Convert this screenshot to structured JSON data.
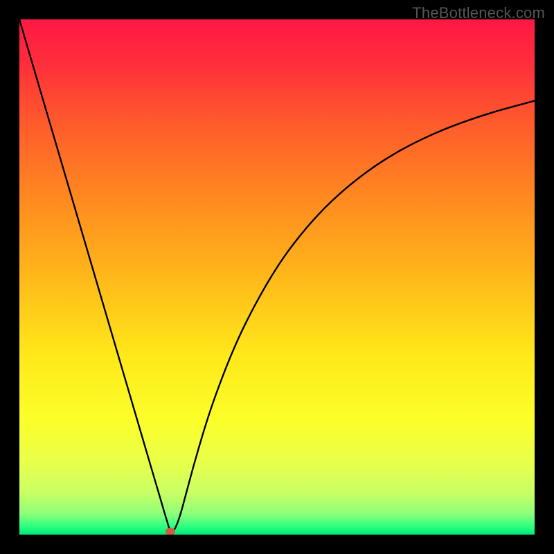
{
  "watermark": "TheBottleneck.com",
  "chart_data": {
    "type": "line",
    "title": "",
    "xlabel": "",
    "ylabel": "",
    "xlim": [
      0,
      100
    ],
    "ylim": [
      0,
      100
    ],
    "background_gradient": {
      "stops": [
        {
          "offset": 0.0,
          "color": "#ff1844"
        },
        {
          "offset": 0.08,
          "color": "#ff2c3c"
        },
        {
          "offset": 0.2,
          "color": "#ff5a2c"
        },
        {
          "offset": 0.35,
          "color": "#ff8a20"
        },
        {
          "offset": 0.5,
          "color": "#ffb81a"
        },
        {
          "offset": 0.65,
          "color": "#ffe81a"
        },
        {
          "offset": 0.78,
          "color": "#fbff2a"
        },
        {
          "offset": 0.86,
          "color": "#e8ff4a"
        },
        {
          "offset": 0.92,
          "color": "#c8ff65"
        },
        {
          "offset": 0.96,
          "color": "#8cff7a"
        },
        {
          "offset": 0.985,
          "color": "#2aff82"
        },
        {
          "offset": 1.0,
          "color": "#00e876"
        }
      ]
    },
    "series": [
      {
        "name": "bottleneck-curve",
        "x": [
          0.0,
          2,
          4,
          6,
          8,
          10,
          12,
          14,
          16,
          18,
          20,
          22,
          24,
          25.5,
          26.5,
          27.3,
          28.0,
          28.6,
          29.0,
          29.3,
          29.7,
          30.2,
          30.8,
          31.5,
          32.5,
          34,
          36,
          38,
          41,
          44,
          48,
          52,
          57,
          62,
          68,
          74,
          80,
          86,
          92,
          100
        ],
        "y": [
          100,
          93.2,
          86.4,
          79.6,
          72.8,
          66.0,
          59.2,
          52.4,
          45.6,
          38.8,
          32.0,
          25.2,
          18.4,
          13.3,
          9.9,
          7.2,
          4.8,
          2.8,
          1.5,
          0.7,
          0.6,
          1.2,
          2.6,
          4.8,
          8.5,
          14.0,
          20.8,
          26.8,
          34.6,
          41.2,
          48.6,
          54.8,
          61.0,
          66.0,
          70.8,
          74.6,
          77.6,
          80.0,
          82.0,
          84.2
        ]
      }
    ],
    "marker": {
      "x": 29.3,
      "y": 0.6,
      "color": "#d05a44"
    }
  }
}
